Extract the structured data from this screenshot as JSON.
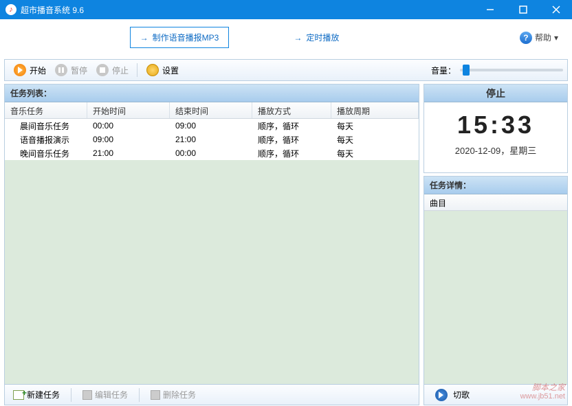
{
  "window": {
    "title": "超市播音系统 9.6"
  },
  "topnav": {
    "make_mp3": "制作语音播报MP3",
    "timed_play": "定时播放",
    "help": "帮助"
  },
  "toolbar": {
    "start": "开始",
    "pause": "暂停",
    "stop": "停止",
    "settings": "设置",
    "volume_label": "音量："
  },
  "task_list": {
    "title": "任务列表：",
    "columns": {
      "c1": "音乐任务",
      "c2": "开始时间",
      "c3": "结束时间",
      "c4": "播放方式",
      "c5": "播放周期"
    },
    "rows": [
      {
        "name": "晨间音乐任务",
        "start": "00:00",
        "end": "09:00",
        "mode": "顺序，循环",
        "cycle": "每天"
      },
      {
        "name": "语音播报演示",
        "start": "09:00",
        "end": "21:00",
        "mode": "顺序，循环",
        "cycle": "每天"
      },
      {
        "name": "晚间音乐任务",
        "start": "21:00",
        "end": "00:00",
        "mode": "顺序，循环",
        "cycle": "每天"
      }
    ],
    "buttons": {
      "new": "新建任务",
      "edit": "编辑任务",
      "delete": "删除任务"
    }
  },
  "status": {
    "label": "停止",
    "time": "15:33",
    "date": "2020-12-09，星期三"
  },
  "details": {
    "title": "任务详情：",
    "track_col": "曲目",
    "skip": "切歌"
  },
  "watermark": {
    "text": "脚本之家",
    "url": "www.jb51.net"
  }
}
